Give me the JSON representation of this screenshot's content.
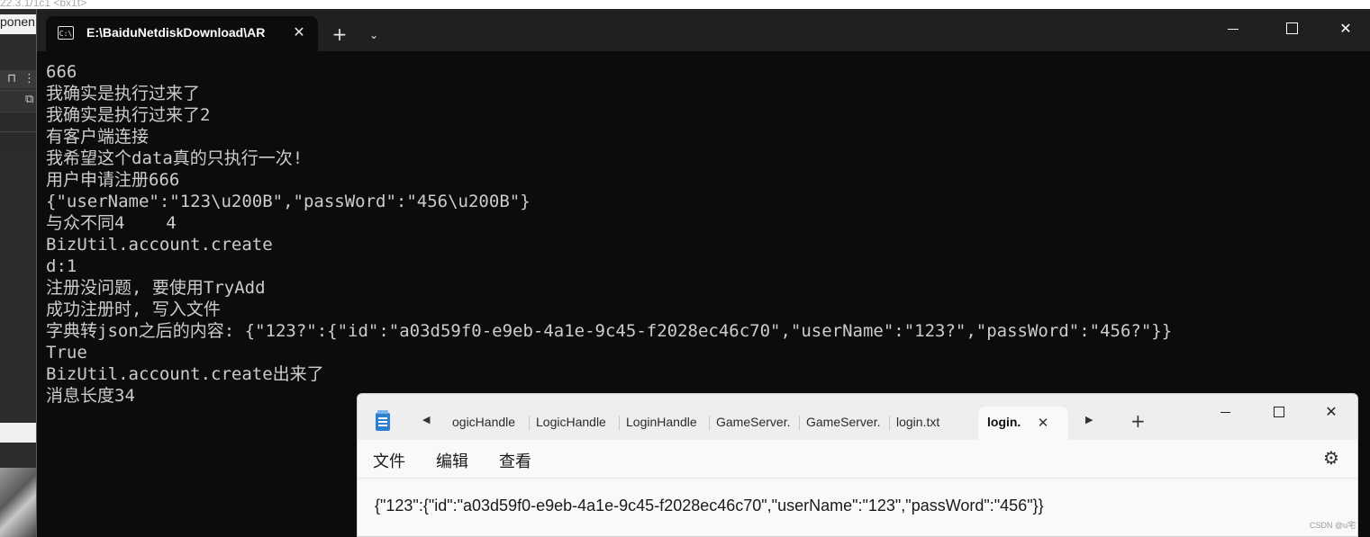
{
  "background": {
    "top_text": "22.3.1/1c1 <bx1t>",
    "left_label": "ponen"
  },
  "terminal": {
    "tab_title": "E:\\BaiduNetdiskDownload\\AR",
    "tab_icon": "C:\\",
    "close_glyph": "✕",
    "newtab_glyph": "+",
    "dropdown_glyph": "⌄",
    "close_window_glyph": "✕",
    "output": [
      "666",
      "我确实是执行过来了",
      "我确实是执行过来了2",
      "有客户端连接",
      "我希望这个data真的只执行一次!",
      "用户申请注册666",
      "{\"userName\":\"123\\u200B\",\"passWord\":\"456\\u200B\"}",
      "与众不同4    4",
      "BizUtil.account.create",
      "d:1",
      "注册没问题, 要使用TryAdd",
      "成功注册时, 写入文件",
      "字典转json之后的内容: {\"123?\":{\"id\":\"a03d59f0-e9eb-4a1e-9c45-f2028ec46c70\",\"userName\":\"123?\",\"passWord\":\"456?\"}}",
      "True",
      "BizUtil.account.create出来了",
      "消息长度34"
    ]
  },
  "notepad": {
    "tabs": [
      "ogicHandle",
      "LogicHandle",
      "LoginHandle",
      "GameServer.",
      "GameServer.",
      "login.txt"
    ],
    "active_tab": "login.",
    "close_glyph": "✕",
    "newtab_glyph": "+",
    "scroll_left_glyph": "◀",
    "scroll_right_glyph": "▶",
    "close_window_glyph": "✕",
    "settings_glyph": "⚙",
    "menu": {
      "file": "文件",
      "edit": "编辑",
      "view": "查看"
    },
    "content": "{\"123\":{\"id\":\"a03d59f0-e9eb-4a1e-9c45-f2028ec46c70\",\"userName\":\"123\",\"passWord\":\"456\"}}"
  },
  "watermark": "CSDN @u宅"
}
